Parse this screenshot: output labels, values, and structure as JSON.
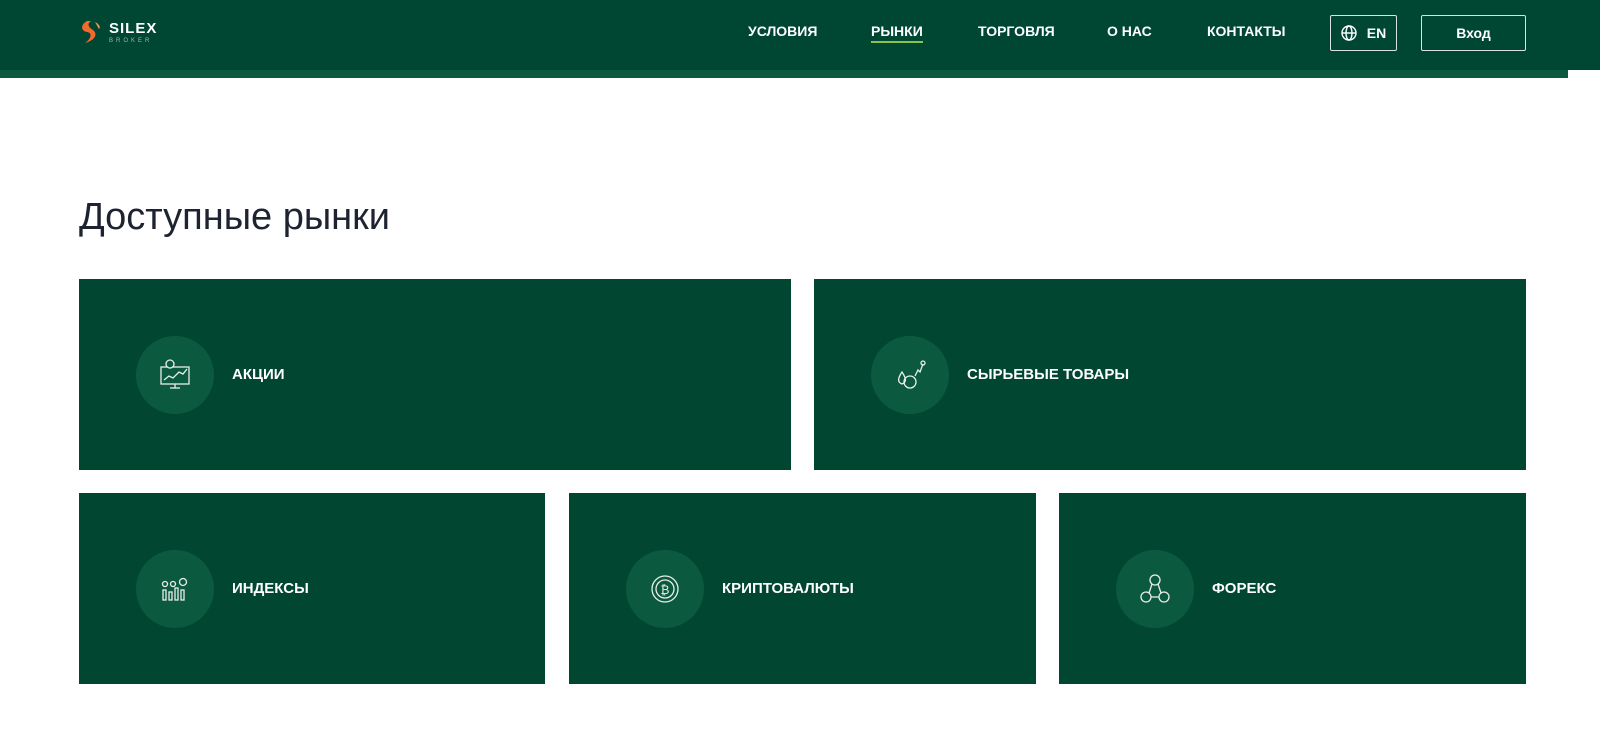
{
  "header": {
    "logo_name": "SILEX",
    "logo_sub": "BROKER",
    "nav": [
      {
        "label": "УСЛОВИЯ"
      },
      {
        "label": "РЫНКИ"
      },
      {
        "label": "ТОРГОВЛЯ"
      },
      {
        "label": "О НАС"
      },
      {
        "label": "КОНТАКТЫ"
      }
    ],
    "lang": "EN",
    "login": "Вход"
  },
  "main": {
    "title": "Доступные рынки",
    "markets": [
      {
        "label": "АКЦИИ",
        "icon": "stock-monitor-icon"
      },
      {
        "label": "СЫРЬЕВЫЕ ТОВАРЫ",
        "icon": "commodities-icon"
      },
      {
        "label": "ИНДЕКСЫ",
        "icon": "indices-icon"
      },
      {
        "label": "КРИПТОВАЛЮТЫ",
        "icon": "bitcoin-icon"
      },
      {
        "label": "ФОРЕКС",
        "icon": "forex-icon"
      }
    ]
  },
  "colors": {
    "brand": "#004733",
    "card": "#014631",
    "accent": "#8bc34a",
    "logo": "#f26a2e"
  }
}
